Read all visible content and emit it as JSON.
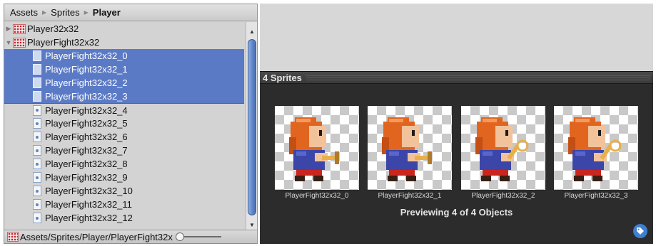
{
  "breadcrumb": [
    "Assets",
    "Sprites",
    "Player"
  ],
  "tree": [
    {
      "label": "Player32x32",
      "kind": "texture",
      "expanded": false,
      "selected": false
    },
    {
      "label": "PlayerFight32x32",
      "kind": "texture",
      "expanded": true,
      "selected": false
    },
    {
      "label": "PlayerFight32x32_0",
      "kind": "sprite",
      "selected": true
    },
    {
      "label": "PlayerFight32x32_1",
      "kind": "sprite",
      "selected": true
    },
    {
      "label": "PlayerFight32x32_2",
      "kind": "sprite",
      "selected": true
    },
    {
      "label": "PlayerFight32x32_3",
      "kind": "sprite",
      "selected": true
    },
    {
      "label": "PlayerFight32x32_4",
      "kind": "sprite",
      "selected": false
    },
    {
      "label": "PlayerFight32x32_5",
      "kind": "sprite",
      "selected": false
    },
    {
      "label": "PlayerFight32x32_6",
      "kind": "sprite",
      "selected": false
    },
    {
      "label": "PlayerFight32x32_7",
      "kind": "sprite",
      "selected": false
    },
    {
      "label": "PlayerFight32x32_8",
      "kind": "sprite",
      "selected": false
    },
    {
      "label": "PlayerFight32x32_9",
      "kind": "sprite",
      "selected": false
    },
    {
      "label": "PlayerFight32x32_10",
      "kind": "sprite",
      "selected": false
    },
    {
      "label": "PlayerFight32x32_11",
      "kind": "sprite",
      "selected": false
    },
    {
      "label": "PlayerFight32x32_12",
      "kind": "sprite",
      "selected": false
    }
  ],
  "status_path": "Assets/Sprites/Player/PlayerFight32x",
  "preview": {
    "title": "4 Sprites",
    "sprites": [
      {
        "label": "PlayerFight32x32_0",
        "weapon": "sword-down"
      },
      {
        "label": "PlayerFight32x32_1",
        "weapon": "sword-down"
      },
      {
        "label": "PlayerFight32x32_2",
        "weapon": "sword-up"
      },
      {
        "label": "PlayerFight32x32_3",
        "weapon": "sword-up"
      }
    ],
    "status": "Previewing 4 of 4 Objects"
  },
  "colors": {
    "selection": "#5b7ac6",
    "hair": "#e2651f",
    "shirt": "#3b46a8",
    "pants": "#c9261f"
  }
}
